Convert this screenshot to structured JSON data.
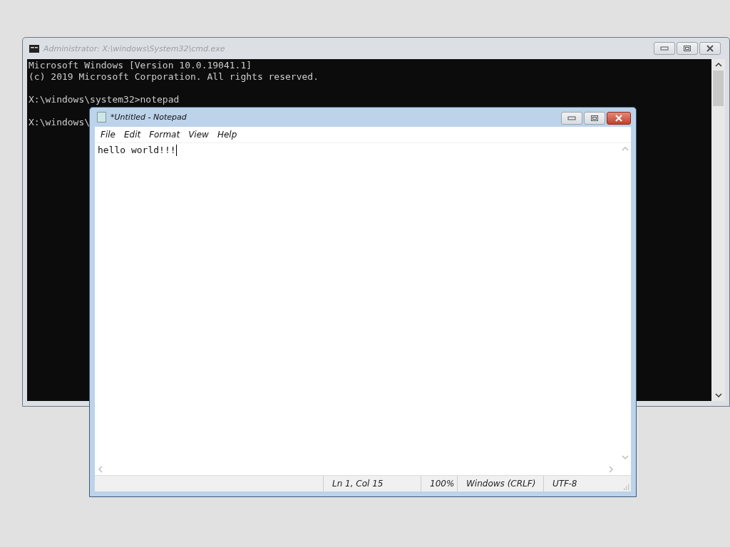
{
  "console_window": {
    "title": "Administrator: X:\\windows\\System32\\cmd.exe",
    "active": false,
    "blocks": [
      [
        "Microsoft Windows [Version 10.0.19041.1]",
        "(c) 2019 Microsoft Corporation. All rights reserved."
      ],
      [
        "X:\\windows\\system32>notepad"
      ],
      [
        "X:\\windows\\"
      ]
    ]
  },
  "notepad_window": {
    "title": "*Untitled - Notepad",
    "active": true,
    "menu": [
      "File",
      "Edit",
      "Format",
      "View",
      "Help"
    ],
    "text": "hello world!!!",
    "status_bar": [
      "Ln 1, Col 15",
      "100%",
      "Windows (CRLF)",
      "UTF-8"
    ]
  }
}
